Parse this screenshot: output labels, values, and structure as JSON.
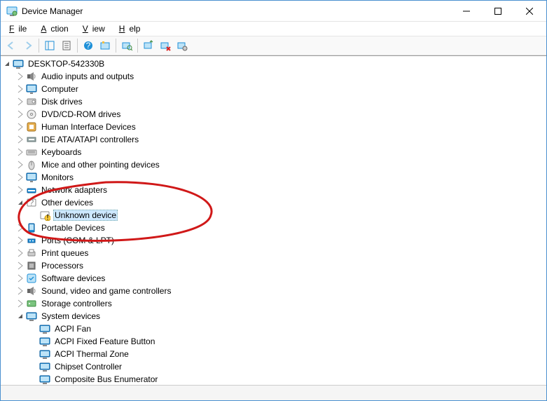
{
  "window": {
    "title": "Device Manager"
  },
  "menu": {
    "file": "File",
    "action": "Action",
    "view": "View",
    "help": "Help"
  },
  "toolbar": {
    "back": "Back",
    "forward": "Forward",
    "show_hide_tree": "Show/Hide Console Tree",
    "properties": "Properties",
    "help": "Help",
    "show_hidden": "Show hidden devices",
    "scan": "Scan for hardware changes",
    "add_legacy": "Add legacy hardware",
    "uninstall": "Uninstall device",
    "update_driver": "Update driver"
  },
  "tree": {
    "root": "DESKTOP-542330B",
    "categories": [
      {
        "label": "Audio inputs and outputs",
        "icon": "speaker",
        "expanded": false
      },
      {
        "label": "Computer",
        "icon": "monitor",
        "expanded": false
      },
      {
        "label": "Disk drives",
        "icon": "disk",
        "expanded": false
      },
      {
        "label": "DVD/CD-ROM drives",
        "icon": "disc",
        "expanded": false
      },
      {
        "label": "Human Interface Devices",
        "icon": "hid",
        "expanded": false
      },
      {
        "label": "IDE ATA/ATAPI controllers",
        "icon": "ide",
        "expanded": false
      },
      {
        "label": "Keyboards",
        "icon": "keyboard",
        "expanded": false
      },
      {
        "label": "Mice and other pointing devices",
        "icon": "mouse",
        "expanded": false
      },
      {
        "label": "Monitors",
        "icon": "monitor",
        "expanded": false
      },
      {
        "label": "Network adapters",
        "icon": "network",
        "expanded": false
      },
      {
        "label": "Other devices",
        "icon": "other",
        "expanded": true,
        "children": [
          {
            "label": "Unknown device",
            "icon": "unknown",
            "selected": true
          }
        ]
      },
      {
        "label": "Portable Devices",
        "icon": "portable",
        "expanded": false
      },
      {
        "label": "Ports (COM & LPT)",
        "icon": "port",
        "expanded": false
      },
      {
        "label": "Print queues",
        "icon": "printer",
        "expanded": false
      },
      {
        "label": "Processors",
        "icon": "processor",
        "expanded": false
      },
      {
        "label": "Software devices",
        "icon": "software",
        "expanded": false
      },
      {
        "label": "Sound, video and game controllers",
        "icon": "speaker",
        "expanded": false
      },
      {
        "label": "Storage controllers",
        "icon": "storage",
        "expanded": false
      },
      {
        "label": "System devices",
        "icon": "system",
        "expanded": true,
        "children": [
          {
            "label": "ACPI Fan",
            "icon": "system"
          },
          {
            "label": "ACPI Fixed Feature Button",
            "icon": "system"
          },
          {
            "label": "ACPI Thermal Zone",
            "icon": "system"
          },
          {
            "label": "Chipset Controller",
            "icon": "system"
          },
          {
            "label": "Composite Bus Enumerator",
            "icon": "system"
          }
        ]
      }
    ]
  }
}
